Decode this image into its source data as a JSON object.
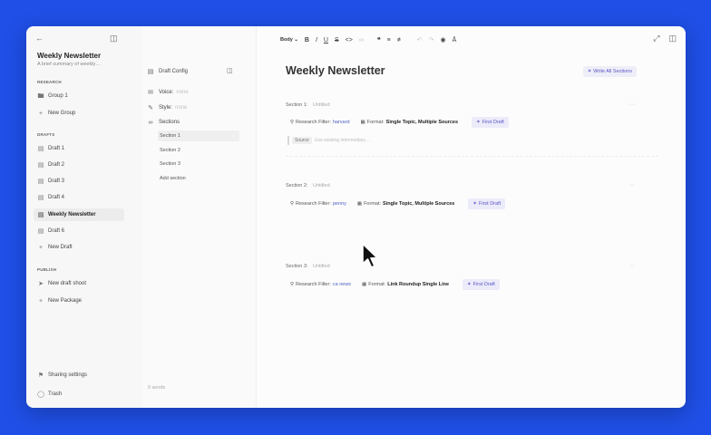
{
  "sidebar": {
    "title": "Weekly Newsletter",
    "subtitle": "A brief summary of weekly…",
    "research_label": "RESEARCH",
    "research_items": [
      {
        "label": "Group 1",
        "icon": "folder-icon"
      },
      {
        "label": "New Group",
        "icon": "plus-icon"
      }
    ],
    "drafts_label": "DRAFTS",
    "draft_items": [
      {
        "label": "Draft 1"
      },
      {
        "label": "Draft 2"
      },
      {
        "label": "Draft 3"
      },
      {
        "label": "Draft 4"
      },
      {
        "label": "Weekly Newsletter"
      },
      {
        "label": "Draft 6"
      },
      {
        "label": "New Draft"
      }
    ],
    "publish_label": "PUBLISH",
    "publish_items": [
      {
        "label": "New draft shoot"
      },
      {
        "label": "New Package"
      }
    ],
    "footer_items": [
      {
        "label": "Sharing settings"
      },
      {
        "label": "Trash"
      }
    ]
  },
  "config": {
    "draft_config": "Draft Config",
    "voice_label": "Voice:",
    "voice_value": "none",
    "style_label": "Style:",
    "style_value": "none",
    "sections_label": "Sections",
    "sections": [
      "Section 1",
      "Section 2",
      "Section 3"
    ],
    "add_section": "Add section",
    "word_count": "0 words"
  },
  "toolbar": {
    "style_select": "Body"
  },
  "main": {
    "title": "Weekly Newsletter",
    "write_all": "Write All Sections",
    "sections": [
      {
        "label": "Section 1:",
        "name": "Untitled",
        "filter_label": "Research Filter:",
        "filter_value": "harvard",
        "format_label": "Format:",
        "format_value": "Single Topic, Multiple Sources",
        "action": "First Draft"
      },
      {
        "label": "Section 2:",
        "name": "Untitled",
        "filter_label": "Research Filter:",
        "filter_value": "penny",
        "format_label": "Format:",
        "format_value": "Single Topic, Multiple Sources",
        "action": "First Draft"
      },
      {
        "label": "Section 3:",
        "name": "Untitled",
        "filter_label": "Research Filter:",
        "filter_value": "ca news",
        "format_label": "Format:",
        "format_value": "Link Roundup Single Line",
        "action": "First Draft"
      }
    ],
    "sources_label": "Source",
    "sources_placeholder": "Use existing intermediary…"
  },
  "colors": {
    "background": "#1f4fe6",
    "accent": "#5a55c7",
    "link": "#4f5fc4"
  }
}
